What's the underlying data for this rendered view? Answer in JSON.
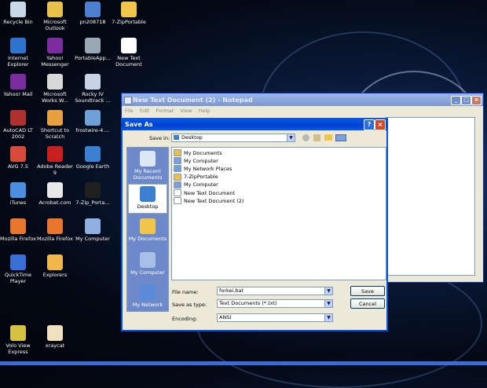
{
  "desktop": {
    "icons": [
      {
        "label": "Recycle Bin",
        "icon": "recycle-bin-icon",
        "color": "#c8d8e8"
      },
      {
        "label": "Microsoft Outlook",
        "icon": "outlook-icon",
        "color": "#e7c14a"
      },
      {
        "label": "pn208718",
        "icon": "program-icon",
        "color": "#4d7fd0"
      },
      {
        "label": "7-ZipPortable",
        "icon": "folder-icon",
        "color": "#f0c64a"
      },
      {
        "label": "Internet Explorer",
        "icon": "internet-explorer-icon",
        "color": "#2f74d0"
      },
      {
        "label": "Yahoo! Messenger",
        "icon": "yahoo-messenger-icon",
        "color": "#7b2da0"
      },
      {
        "label": "PortableApp...",
        "icon": "portableapps-icon",
        "color": "#9aa8b6"
      },
      {
        "label": "New Text Document",
        "icon": "text-document-icon",
        "color": "#ffffff"
      },
      {
        "label": "Yahoo! Mail",
        "icon": "yahoo-mail-icon",
        "color": "#7b2da0"
      },
      {
        "label": "Microsoft Works W...",
        "icon": "works-icon",
        "color": "#d8d8d8"
      },
      {
        "label": "Rocky IV Soundtrack ...",
        "icon": "audio-file-icon",
        "color": "#c9d3e6"
      },
      {
        "label": "AutoCAD LT 2002",
        "icon": "autocad-icon",
        "color": "#b03030"
      },
      {
        "label": "Shortcut to Scratch",
        "icon": "scratch-icon",
        "color": "#e8a040"
      },
      {
        "label": "frostwire-4....",
        "icon": "frostwire-icon",
        "color": "#6fa0d8"
      },
      {
        "label": "AVG 7.5",
        "icon": "avg-icon",
        "color": "#d84b3a"
      },
      {
        "label": "Adobe Reader 9",
        "icon": "adobe-reader-icon",
        "color": "#c82020"
      },
      {
        "label": "Google Earth",
        "icon": "google-earth-icon",
        "color": "#3a7fd0"
      },
      {
        "label": "iTunes",
        "icon": "itunes-icon",
        "color": "#4a8fe0"
      },
      {
        "label": "Acrobat.com",
        "icon": "acrobat-icon",
        "color": "#e8e8e8"
      },
      {
        "label": "7-Zip_Porta...",
        "icon": "7zip-icon",
        "color": "#202020"
      },
      {
        "label": "Mozilla Firefox",
        "icon": "firefox-icon",
        "color": "#e8762c"
      },
      {
        "label": "Mozilla Firefox",
        "icon": "firefox-icon",
        "color": "#e8762c"
      },
      {
        "label": "My Computer",
        "icon": "my-computer-icon",
        "color": "#8fb0e0"
      },
      {
        "label": "QuickTime Player",
        "icon": "quicktime-icon",
        "color": "#3a6fd8"
      },
      {
        "label": "Explorers",
        "icon": "explorers-icon",
        "color": "#f0b84a"
      },
      {
        "label": "Volo View Express",
        "icon": "volo-view-icon",
        "color": "#d8c040"
      },
      {
        "label": "xraycat",
        "icon": "xraycat-icon",
        "color": "#f0e0c0"
      }
    ]
  },
  "notepad": {
    "title": "New Text Document (2) - Notepad",
    "menu": [
      "File",
      "Edit",
      "Format",
      "View",
      "Help"
    ]
  },
  "dialog": {
    "title": "Save As",
    "save_in_label": "Save in:",
    "save_in_value": "Desktop",
    "places": [
      {
        "label": "My Recent Documents",
        "icon": "recent-documents-icon"
      },
      {
        "label": "Desktop",
        "icon": "desktop-icon"
      },
      {
        "label": "My Documents",
        "icon": "my-documents-icon"
      },
      {
        "label": "My Computer",
        "icon": "my-computer-icon"
      },
      {
        "label": "My Network",
        "icon": "my-network-icon"
      }
    ],
    "files": [
      {
        "name": "My Documents",
        "icon": "folder-icon",
        "color": "#e8c050"
      },
      {
        "name": "My Computer",
        "icon": "computer-icon",
        "color": "#7f9fd8"
      },
      {
        "name": "My Network Places",
        "icon": "network-icon",
        "color": "#6fa0d8"
      },
      {
        "name": "7-ZipPortable",
        "icon": "folder-icon",
        "color": "#e8c050"
      },
      {
        "name": "My Computer",
        "icon": "computer-icon",
        "color": "#7f9fd8"
      },
      {
        "name": "New Text Document",
        "icon": "text-document-icon",
        "color": "#ffffff"
      },
      {
        "name": "New Text Document (2)",
        "icon": "text-document-icon",
        "color": "#ffffff"
      }
    ],
    "file_name_label": "File name:",
    "file_name_value": "forkei.bat",
    "save_as_type_label": "Save as type:",
    "save_as_type_value": "Text Documents (*.txt)",
    "encoding_label": "Encoding:",
    "encoding_value": "ANSI",
    "save_button": "Save",
    "cancel_button": "Cancel"
  }
}
